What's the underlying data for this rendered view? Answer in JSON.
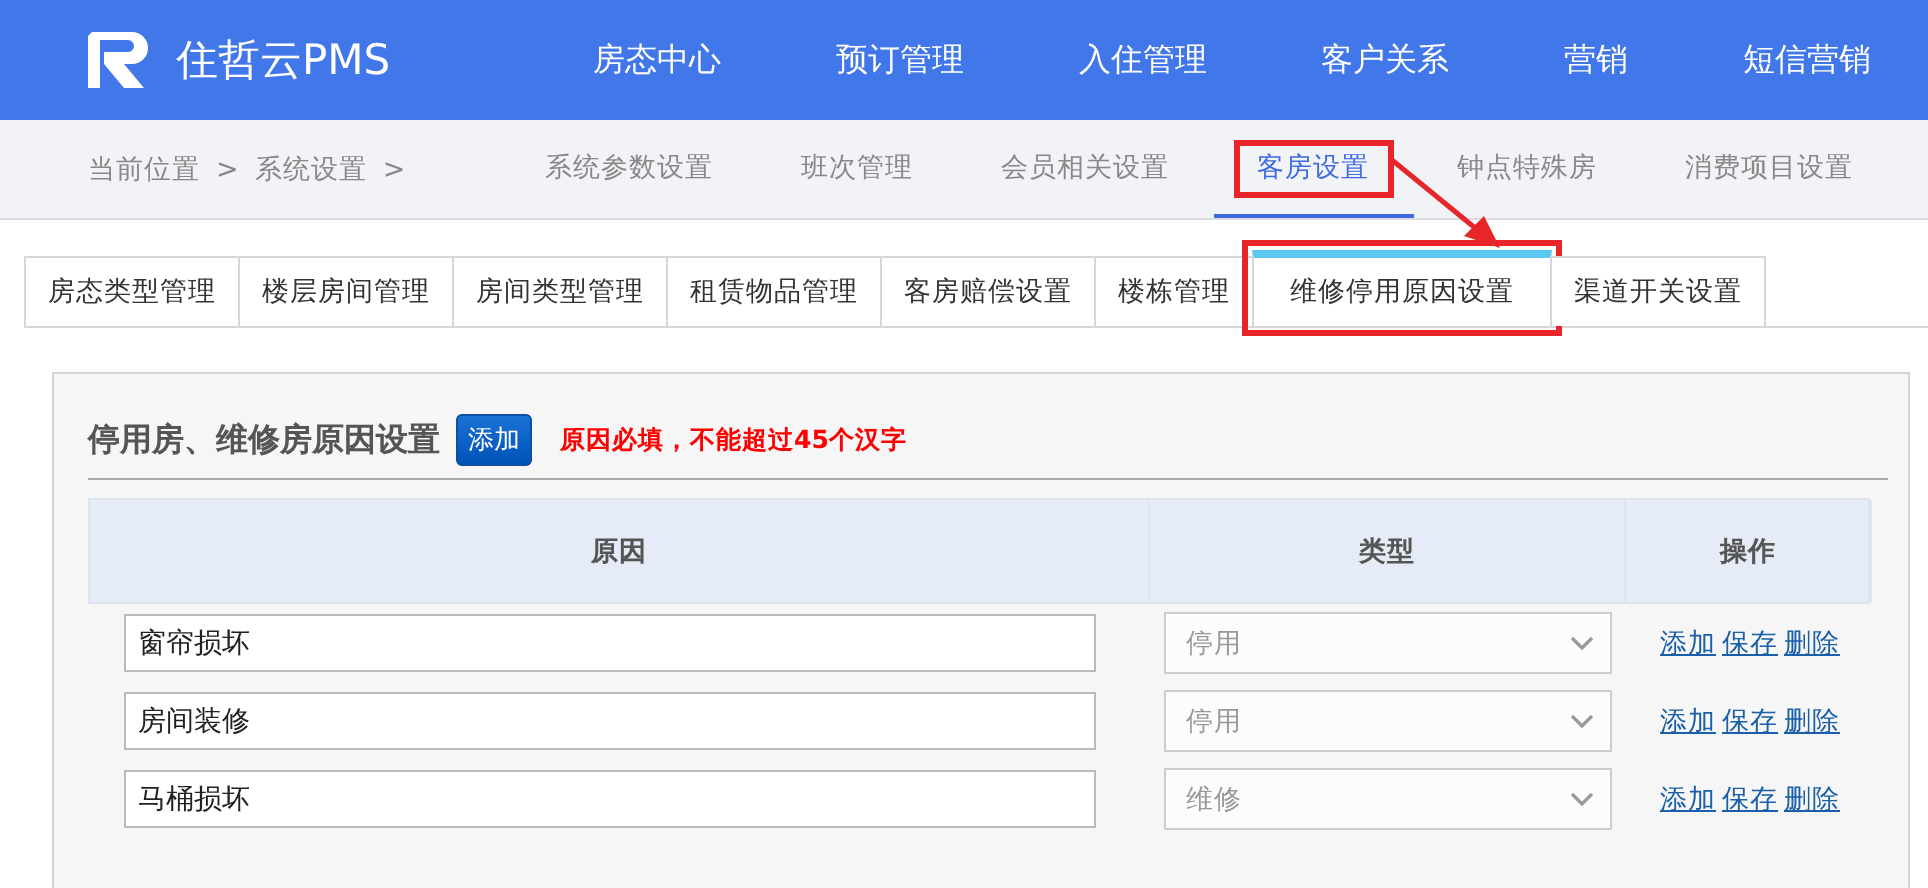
{
  "header": {
    "brand": "住哲云PMS",
    "nav": [
      "房态中心",
      "预订管理",
      "入住管理",
      "客户关系",
      "营销",
      "短信营销"
    ]
  },
  "breadcrumb": {
    "items": [
      "当前位置",
      "系统设置"
    ],
    "separator": ">"
  },
  "subnav": [
    {
      "label": "系统参数设置",
      "selected": false,
      "highlighted": false
    },
    {
      "label": "班次管理",
      "selected": false,
      "highlighted": false
    },
    {
      "label": "会员相关设置",
      "selected": false,
      "highlighted": false
    },
    {
      "label": "客房设置",
      "selected": true,
      "highlighted": true
    },
    {
      "label": "钟点特殊房",
      "selected": false,
      "highlighted": false
    },
    {
      "label": "消费项目设置",
      "selected": false,
      "highlighted": false
    }
  ],
  "tabs": [
    {
      "label": "房态类型管理",
      "selected": false,
      "highlighted": false
    },
    {
      "label": "楼层房间管理",
      "selected": false,
      "highlighted": false
    },
    {
      "label": "房间类型管理",
      "selected": false,
      "highlighted": false
    },
    {
      "label": "租赁物品管理",
      "selected": false,
      "highlighted": false
    },
    {
      "label": "客房赔偿设置",
      "selected": false,
      "highlighted": false
    },
    {
      "label": "楼栋管理",
      "selected": false,
      "highlighted": false
    },
    {
      "label": "维修停用原因设置",
      "selected": true,
      "highlighted": true
    },
    {
      "label": "渠道开关设置",
      "selected": false,
      "highlighted": false
    }
  ],
  "section": {
    "title": "停用房、维修房原因设置",
    "add_button": "添加",
    "hint": "原因必填，不能超过45个汉字"
  },
  "table": {
    "columns": [
      "原因",
      "类型",
      "操作"
    ],
    "rows": [
      {
        "reason": "窗帘损坏",
        "type": "停用",
        "actions": [
          "添加",
          "保存",
          "删除"
        ]
      },
      {
        "reason": "房间装修",
        "type": "停用",
        "actions": [
          "添加",
          "保存",
          "删除"
        ]
      },
      {
        "reason": "马桶损坏",
        "type": "维修",
        "actions": [
          "添加",
          "保存",
          "删除"
        ]
      }
    ]
  }
}
